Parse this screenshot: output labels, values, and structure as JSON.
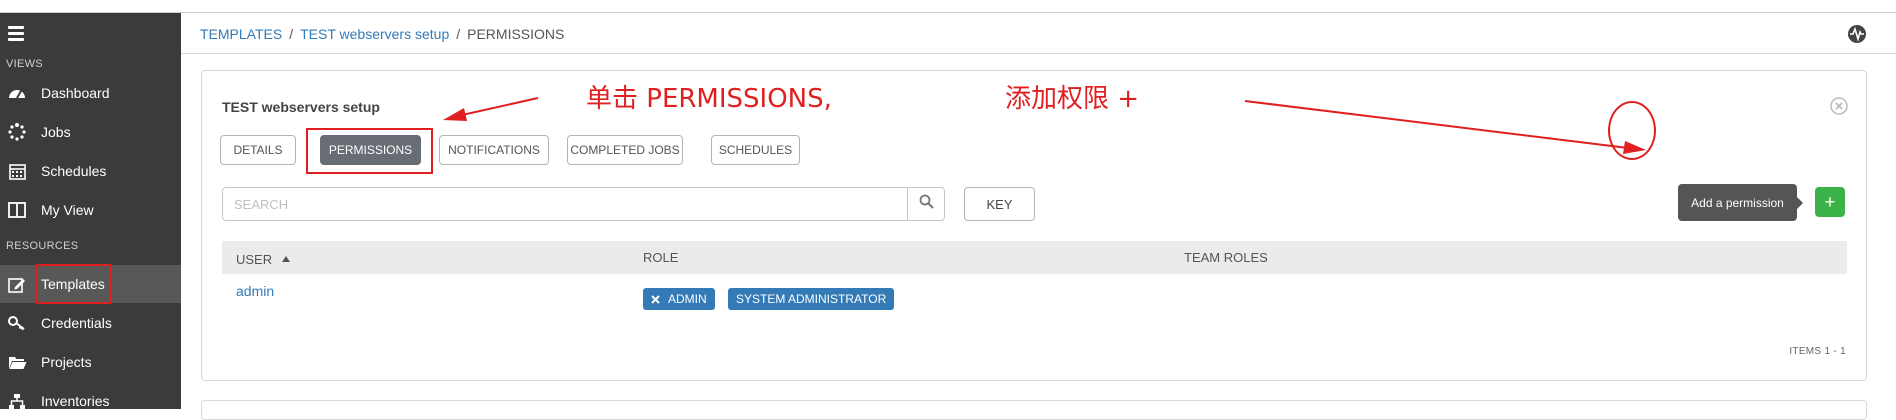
{
  "sidebar": {
    "views_label": "VIEWS",
    "resources_label": "RESOURCES",
    "items": [
      {
        "label": "Dashboard",
        "icon": "dashboard-icon"
      },
      {
        "label": "Jobs",
        "icon": "spinner-icon"
      },
      {
        "label": "Schedules",
        "icon": "calendar-icon"
      },
      {
        "label": "My View",
        "icon": "columns-icon"
      },
      {
        "label": "Templates",
        "icon": "edit-icon"
      },
      {
        "label": "Credentials",
        "icon": "key-icon"
      },
      {
        "label": "Projects",
        "icon": "folder-icon"
      },
      {
        "label": "Inventories",
        "icon": "sitemap-icon"
      }
    ]
  },
  "breadcrumb": {
    "templates": "TEMPLATES",
    "setup": "TEST webservers setup",
    "current": "PERMISSIONS"
  },
  "panel": {
    "title": "TEST webservers setup",
    "tabs": [
      "DETAILS",
      "PERMISSIONS",
      "NOTIFICATIONS",
      "COMPLETED JOBS",
      "SCHEDULES"
    ],
    "active_tab": "PERMISSIONS"
  },
  "search": {
    "placeholder": "SEARCH",
    "key_label": "KEY"
  },
  "tooltip": "Add a permission",
  "add_button": "+",
  "table": {
    "headers": [
      "USER",
      "ROLE",
      "TEAM ROLES"
    ],
    "rows": [
      {
        "user": "admin",
        "roles": [
          "ADMIN",
          "SYSTEM ADMINISTRATOR"
        ]
      }
    ],
    "items_label": "ITEMS  1 - 1"
  },
  "annotations": {
    "click_permissions": "单击 PERMISSIONS,",
    "add_permission": "添加权限 +"
  },
  "colors": {
    "sidebar_bg": "#3b3b3b",
    "accent": "#337ab7",
    "success": "#3cb348",
    "annotation": "#e02020"
  }
}
